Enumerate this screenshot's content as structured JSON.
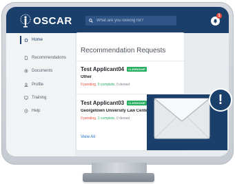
{
  "app": {
    "name": "OSCAR"
  },
  "search": {
    "placeholder": "What are you looking for?"
  },
  "notifications": {
    "count": "1"
  },
  "sidebar": {
    "items": [
      {
        "label": "Home",
        "icon": "home-icon",
        "active": true
      },
      {
        "label": "Recommendations",
        "icon": "document-icon",
        "active": false
      },
      {
        "label": "Documents",
        "icon": "paperclip-icon",
        "active": false
      },
      {
        "label": "Profile",
        "icon": "user-icon",
        "active": false
      },
      {
        "label": "Training",
        "icon": "monitor-icon",
        "active": false
      },
      {
        "label": "Help",
        "icon": "help-icon",
        "active": false
      }
    ]
  },
  "main": {
    "title": "Recommendation Requests",
    "requests": [
      {
        "name": "Test Applicant04",
        "tag": "CLERKSHIP",
        "school": "Other",
        "pending": "0 pending",
        "complete": "0 complete",
        "denied": "0 denied"
      },
      {
        "name": "Test Applicant03",
        "tag": "CLERKSHIP",
        "school": "Georgetown University Law Center",
        "pending": "0 pending",
        "complete": "1 complete",
        "denied": "0 denied"
      }
    ],
    "view_all": "View All"
  },
  "overlay": {
    "alert_symbol": "!"
  },
  "colors": {
    "navy": "#1a3f6b",
    "tag_green": "#27ae60",
    "pending_red": "#e74c3c",
    "link_blue": "#1e6fc2"
  }
}
